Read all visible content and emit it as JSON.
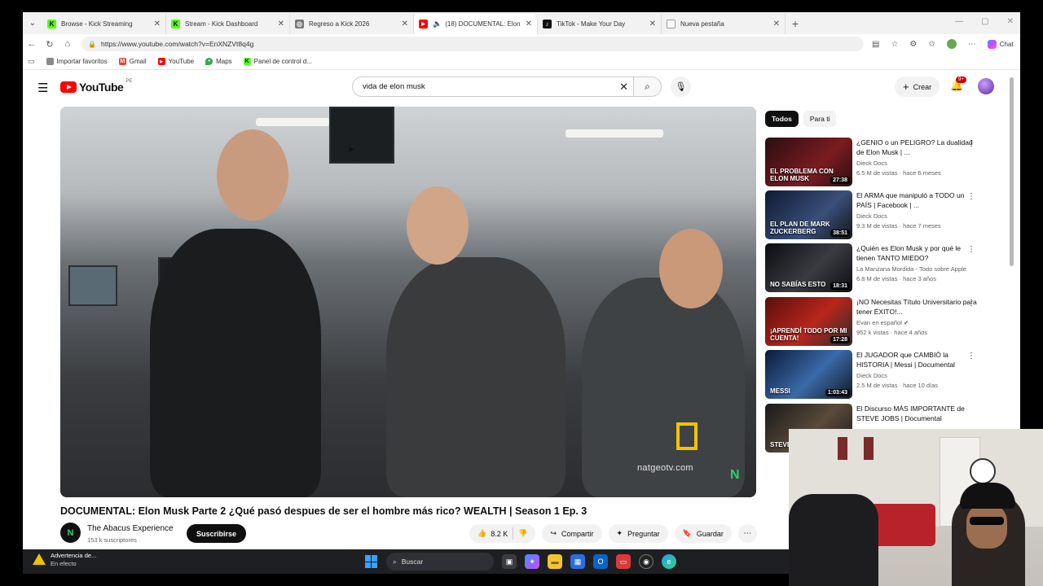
{
  "browser": {
    "tabs": [
      {
        "title": "Browse - Kick Streaming",
        "favicon_color": "#53fc18",
        "glyph": "K"
      },
      {
        "title": "Stream - Kick Dashboard",
        "favicon_color": "#53fc18",
        "glyph": "K"
      },
      {
        "title": "Regreso a Kick 2026",
        "favicon_color": "#777777",
        "glyph": "◎"
      },
      {
        "title": "(18) DOCUMENTAL: Elon Musk",
        "favicon_color": "#ff0000",
        "glyph": "▶"
      },
      {
        "title": "TikTok - Make Your Day",
        "favicon_color": "#111111",
        "glyph": "♪"
      },
      {
        "title": "Nueva pestaña",
        "favicon_color": "#999999",
        "glyph": "▢"
      }
    ],
    "url": "https://www.youtube.com/watch?v=EnXNZVt8q4g",
    "chat_label": "Chat",
    "bookmarks": [
      {
        "label": "Importar favoritos",
        "icon": "folder-icon",
        "color": "#666666"
      },
      {
        "label": "Gmail",
        "icon": "gmail-icon",
        "color": "#ea4335"
      },
      {
        "label": "YouTube",
        "icon": "youtube-icon",
        "color": "#ff0000"
      },
      {
        "label": "Maps",
        "icon": "maps-icon",
        "color": "#34a853"
      },
      {
        "label": "Panel de control d...",
        "icon": "kick-icon",
        "color": "#53fc18"
      }
    ]
  },
  "youtube": {
    "logo_text": "YouTube",
    "country": "PE",
    "search_query": "vida de elon musk",
    "create_label": "Crear",
    "notif_count": "9+",
    "video": {
      "watermark": "natgeotv.com",
      "title": "DOCUMENTAL: Elon Musk Parte 2 ¿Qué pasó despues de ser el hombre más rico? WEALTH | Season 1 Ep. 3",
      "channel": "The Abacus Experience",
      "subscribers": "153 k suscriptores",
      "subscribe_label": "Suscribirse",
      "likes": "8.2 K",
      "share_label": "Compartir",
      "ask_label": "Preguntar",
      "save_label": "Guardar"
    },
    "chips": [
      "Todos",
      "Para ti"
    ],
    "recommendations": [
      {
        "title": "¿GENIO o un PELIGRO? La dualidad de Elon Musk | ...",
        "channel": "Dieck Docs",
        "meta": "6.5 M de vistas · hace 6 meses",
        "duration": "27:38",
        "caption": "EL PROBLEMA CON ELON MUSK",
        "thumb_color": "#3a1418"
      },
      {
        "title": "El ARMA que manipuló a TODO un PAÍS | Facebook | ...",
        "channel": "Dieck Docs",
        "meta": "9.3 M de vistas · hace 7 meses",
        "duration": "38:51",
        "caption": "EL PLAN DE MARK ZUCKERBERG",
        "thumb_color": "#1c2a4a"
      },
      {
        "title": "¿Quién es Elon Musk y por qué le tienen TANTO MIEDO?",
        "channel": "La Manzana Mordida - Todo sobre Apple",
        "meta": "6.8 M de vistas · hace 3 años",
        "duration": "18:31",
        "caption": "NO SABÍAS ESTO",
        "thumb_color": "#16181c"
      },
      {
        "title": "¡NO Necesitas Título Universitario para tener ÉXITO!...",
        "channel": "Evan en español",
        "meta": "952 k vistas · hace 4 años",
        "duration": "17:28",
        "caption": "¡APRENDÍ TODO POR MI CUENTA!",
        "thumb_color": "#8a1a14"
      },
      {
        "title": "El JUGADOR que CAMBIÓ la HISTORIA | Messi | Documental",
        "channel": "Dieck Docs",
        "meta": "2.5 M de vistas · hace 10 días",
        "duration": "1:03:43",
        "caption": "MESSI",
        "thumb_color": "#14284a"
      },
      {
        "title": "El Discurso MÁS IMPORTANTE de STEVE JOBS | Documental",
        "channel": "",
        "meta": "",
        "duration": "",
        "caption": "STEVE",
        "thumb_color": "#2a2a2a"
      }
    ]
  },
  "taskbar": {
    "warning_title": "Advertencia de...",
    "warning_sub": "En efecto",
    "warning_badge": "1",
    "search_placeholder": "Buscar"
  }
}
